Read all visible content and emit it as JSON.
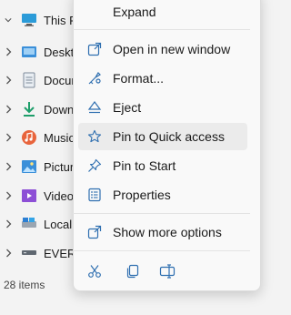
{
  "nav": {
    "items": [
      {
        "label": "This PC",
        "icon": "monitor-icon"
      },
      {
        "label": "Deskto",
        "icon": "desktop-folder-icon"
      },
      {
        "label": "Docun",
        "icon": "documents-folder-icon"
      },
      {
        "label": "Downl",
        "icon": "downloads-arrow-icon"
      },
      {
        "label": "Music",
        "icon": "music-icon"
      },
      {
        "label": "Picture",
        "icon": "pictures-icon"
      },
      {
        "label": "Videos",
        "icon": "videos-icon"
      },
      {
        "label": "Local I",
        "icon": "local-disk-icon"
      },
      {
        "label": "EVERG",
        "icon": "drive-icon"
      }
    ]
  },
  "status": {
    "item_count": "28 items"
  },
  "context_menu": {
    "items": [
      {
        "label": "Expand"
      },
      {
        "label": "Open in new window",
        "icon": "open-in-new-window-icon"
      },
      {
        "label": "Format...",
        "icon": "format-icon"
      },
      {
        "label": "Eject",
        "icon": "eject-icon"
      },
      {
        "label": "Pin to Quick access",
        "icon": "star-icon"
      },
      {
        "label": "Pin to Start",
        "icon": "pin-icon"
      },
      {
        "label": "Properties",
        "icon": "properties-icon"
      },
      {
        "label": "Show more options",
        "icon": "show-more-options-icon"
      }
    ],
    "bottom_actions": [
      "cut-icon",
      "copy-icon",
      "rename-icon"
    ],
    "accent_color": "#2f6fb0"
  }
}
